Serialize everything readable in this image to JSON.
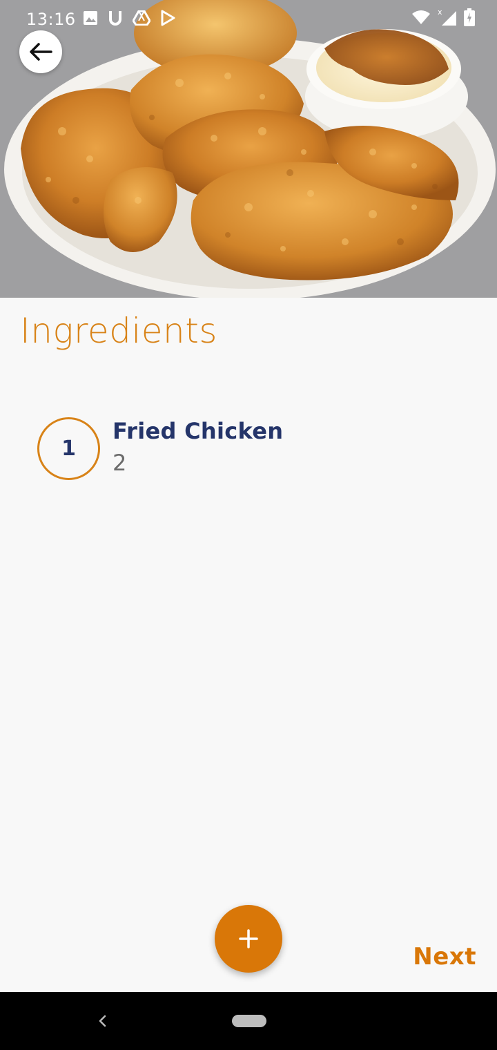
{
  "status_bar": {
    "time": "13:16",
    "left_icons": [
      "image-icon",
      "u-icon",
      "drive-icon",
      "play-store-icon"
    ],
    "right_icons": [
      "wifi-icon",
      "signal-icon",
      "battery-icon"
    ]
  },
  "hero": {
    "image": "fried-chicken-plate",
    "background": "#9f9fa1"
  },
  "page": {
    "title": "Ingredients"
  },
  "ingredients": [
    {
      "number": "1",
      "name": "Fried Chicken",
      "quantity": "2"
    }
  ],
  "actions": {
    "add_symbol": "+",
    "next_label": "Next"
  },
  "colors": {
    "accent": "#d97708",
    "title": "#d88318",
    "ingredient_name": "#25356a",
    "background": "#f8f8f8"
  }
}
